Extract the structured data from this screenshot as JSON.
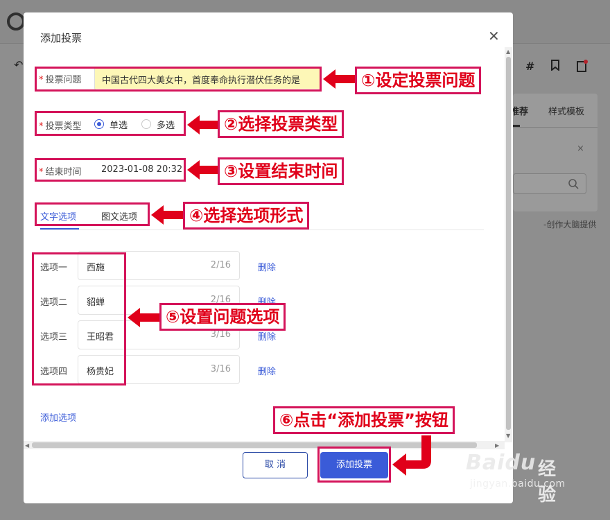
{
  "background": {
    "tabs": [
      "推荐",
      "样式模板"
    ],
    "credit": "-创作大脑提供"
  },
  "dialog": {
    "title": "添加投票",
    "close_icon": "close-icon",
    "question": {
      "label": "投票问题",
      "value": "中国古代四大美女中，首度奉命执行潜伏任务的是"
    },
    "type": {
      "label": "投票类型",
      "options": [
        "单选",
        "多选"
      ],
      "selected": "单选"
    },
    "end_time": {
      "label": "结束时间",
      "value": "2023-01-08 20:32"
    },
    "tabs": [
      "文字选项",
      "图文选项"
    ],
    "active_tab": "文字选项",
    "options": [
      {
        "label": "选项一",
        "value": "西施",
        "count": "2/16",
        "delete": "删除"
      },
      {
        "label": "选项二",
        "value": "貂蝉",
        "count": "2/16",
        "delete": "删除"
      },
      {
        "label": "选项三",
        "value": "王昭君",
        "count": "3/16",
        "delete": "删除"
      },
      {
        "label": "选项四",
        "value": "杨贵妃",
        "count": "3/16",
        "delete": "删除"
      }
    ],
    "add_option": "添加选项",
    "cancel_label": "取 消",
    "submit_label": "添加投票"
  },
  "annotations": [
    "①设定投票问题",
    "②选择投票类型",
    "③设置结束时间",
    "④选择选项形式",
    "⑤设置问题选项",
    "⑥点击“添加投票”按钮"
  ],
  "watermark": {
    "brand": "Baidu",
    "sub": "经验",
    "url": "jingyan.baidu.com"
  },
  "colors": {
    "primary": "#3a5bd8",
    "annotation": "#d4145a",
    "annotation_text": "#e0001a",
    "required": "#e02020",
    "highlight": "#fdf7b7"
  }
}
